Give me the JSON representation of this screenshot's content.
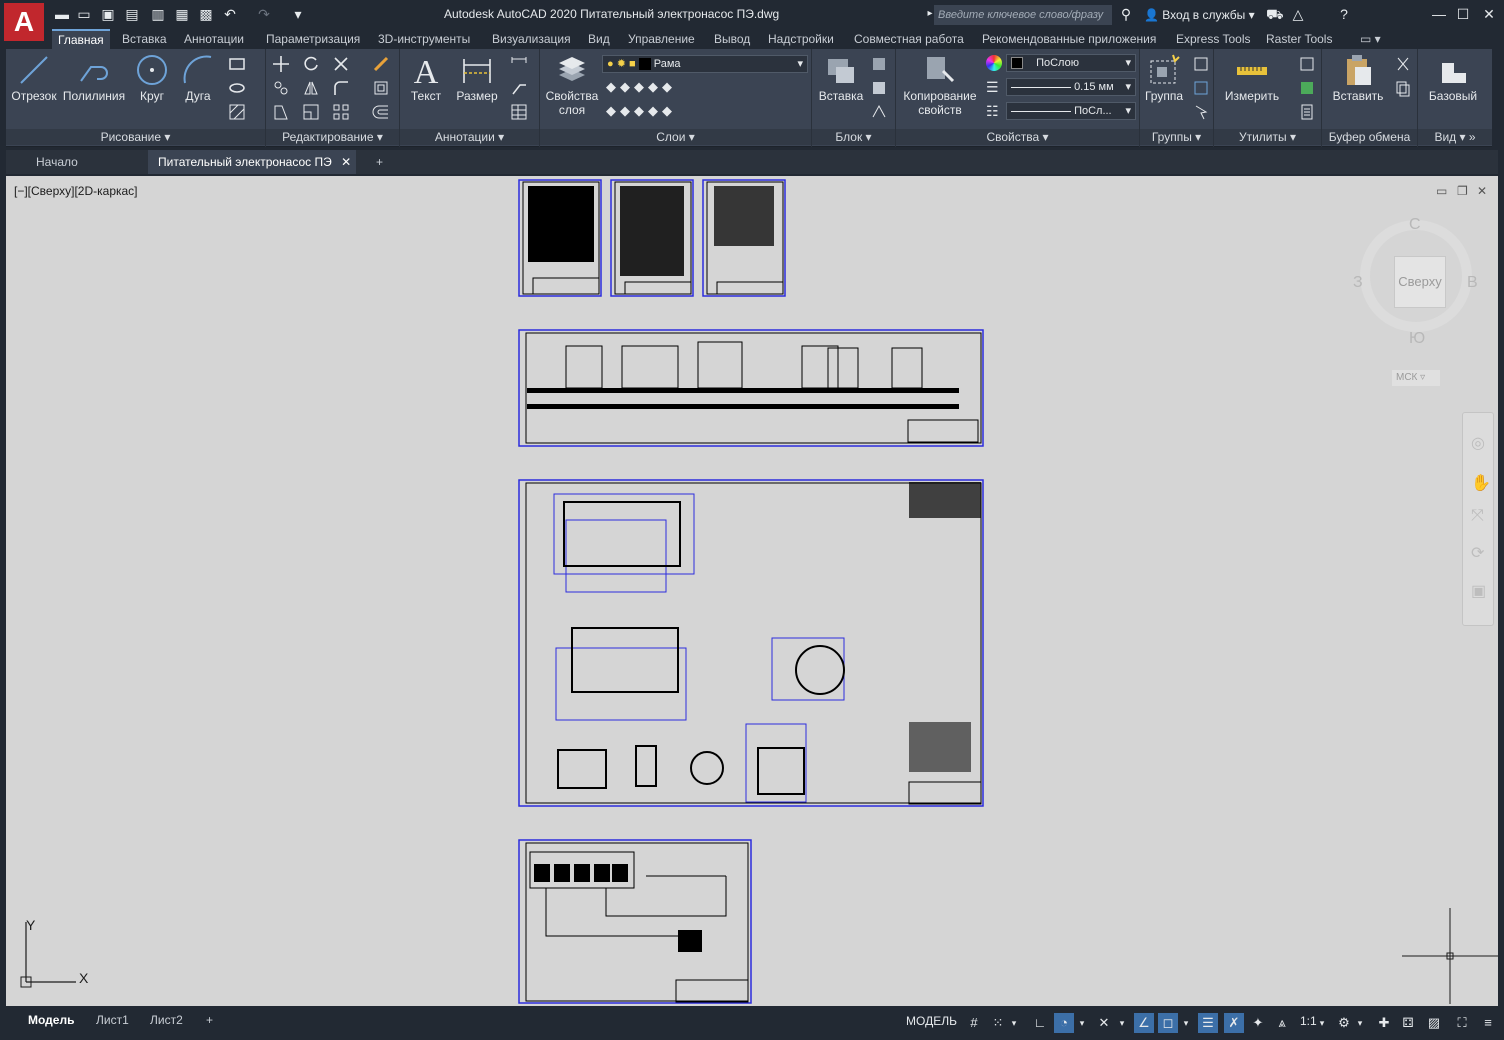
{
  "app": {
    "logo_letter": "A",
    "title": "Autodesk AutoCAD 2020   Питательный электронасос ПЭ.dwg",
    "search_placeholder": "Введите ключевое слово/фразу",
    "signin": "Вход в службы",
    "accent": "#c1272d"
  },
  "ribbon_tabs": [
    "Главная",
    "Вставка",
    "Аннотации",
    "Параметризация",
    "3D-инструменты",
    "Визуализация",
    "Вид",
    "Управление",
    "Вывод",
    "Надстройки",
    "Совместная работа",
    "Рекомендованные приложения",
    "Express Tools",
    "Raster Tools"
  ],
  "ribbon": {
    "draw": {
      "label": "Рисование",
      "line": "Отрезок",
      "polyline": "Полилиния",
      "circle": "Круг",
      "arc": "Дуга"
    },
    "modify": {
      "label": "Редактирование"
    },
    "annotation": {
      "label": "Аннотации",
      "text": "Текст",
      "dimension": "Размер"
    },
    "layers": {
      "label": "Слои",
      "props": "Свойства слоя",
      "current": "Рама"
    },
    "block": {
      "label": "Блок",
      "insert": "Вставка"
    },
    "properties": {
      "label": "Свойства",
      "match": "Копирование свойств",
      "color": "ПоСлою",
      "lineweight": "0.15 мм",
      "linetype": "ПоСл..."
    },
    "groups": {
      "label": "Группы",
      "group": "Группа"
    },
    "utilities": {
      "label": "Утилиты",
      "measure": "Измерить"
    },
    "clipboard": {
      "label": "Буфер обмена",
      "paste": "Вставить"
    },
    "view": {
      "label": "Вид",
      "base": "Базовый"
    }
  },
  "doc_tabs": {
    "start": "Начало",
    "drawing": "Питательный электронасос ПЭ"
  },
  "viewport": {
    "label": "[−][Сверху][2D-каркас]"
  },
  "viewcube": {
    "n": "С",
    "s": "Ю",
    "w": "З",
    "e": "В",
    "face": "Сверху",
    "ucs": "МСК"
  },
  "ucs_icon": {
    "x": "X",
    "y": "Y"
  },
  "layout_tabs": [
    "Модель",
    "Лист1",
    "Лист2"
  ],
  "status": {
    "model": "МОДЕЛЬ",
    "scale": "1:1"
  }
}
